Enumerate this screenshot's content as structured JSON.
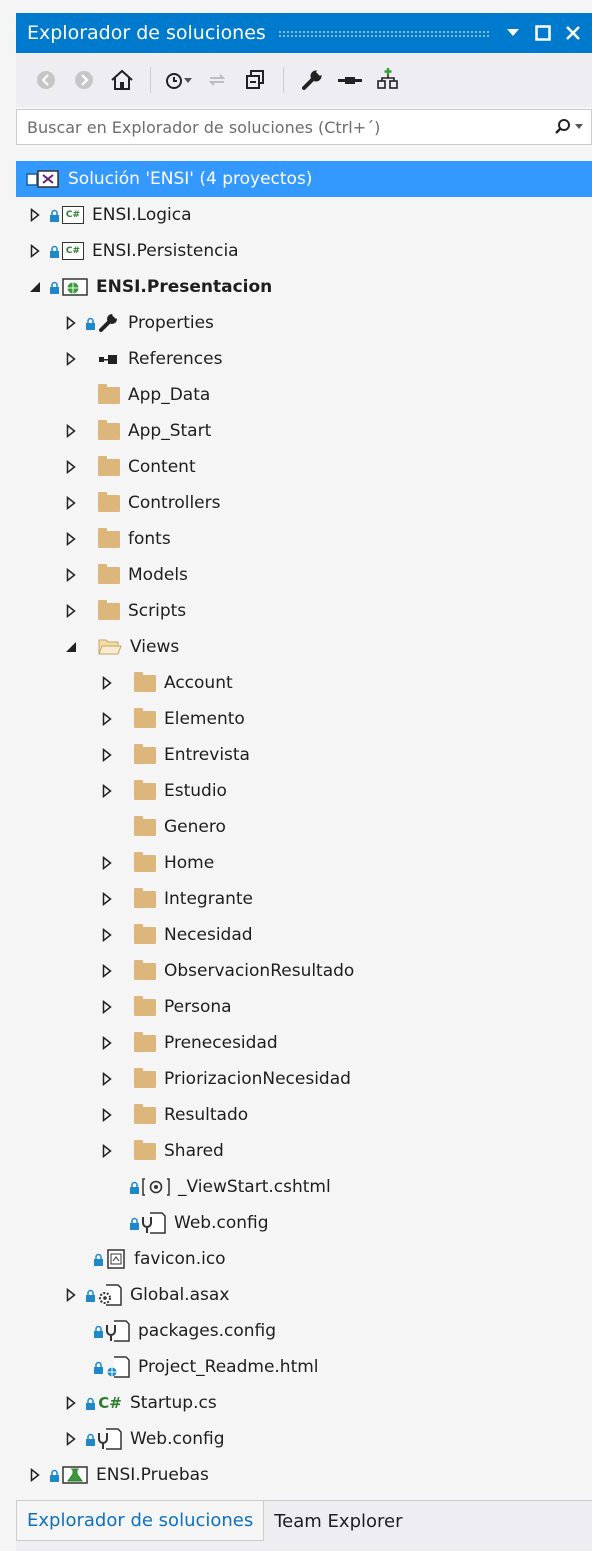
{
  "panel": {
    "title": "Explorador de soluciones"
  },
  "search": {
    "placeholder": "Buscar en Explorador de soluciones (Ctrl+´)"
  },
  "tree": [
    {
      "label": "Solución 'ENSI'  (4 proyectos)"
    },
    {
      "label": "ENSI.Logica"
    },
    {
      "label": "ENSI.Persistencia"
    },
    {
      "label": "ENSI.Presentacion"
    },
    {
      "label": "Properties"
    },
    {
      "label": "References"
    },
    {
      "label": "App_Data"
    },
    {
      "label": "App_Start"
    },
    {
      "label": "Content"
    },
    {
      "label": "Controllers"
    },
    {
      "label": "fonts"
    },
    {
      "label": "Models"
    },
    {
      "label": "Scripts"
    },
    {
      "label": "Views"
    },
    {
      "label": "Account"
    },
    {
      "label": "Elemento"
    },
    {
      "label": "Entrevista"
    },
    {
      "label": "Estudio"
    },
    {
      "label": "Genero"
    },
    {
      "label": "Home"
    },
    {
      "label": "Integrante"
    },
    {
      "label": "Necesidad"
    },
    {
      "label": "ObservacionResultado"
    },
    {
      "label": "Persona"
    },
    {
      "label": "Prenecesidad"
    },
    {
      "label": "PriorizacionNecesidad"
    },
    {
      "label": "Resultado"
    },
    {
      "label": "Shared"
    },
    {
      "label": "_ViewStart.cshtml"
    },
    {
      "label": "Web.config"
    },
    {
      "label": "favicon.ico"
    },
    {
      "label": "Global.asax"
    },
    {
      "label": "packages.config"
    },
    {
      "label": "Project_Readme.html"
    },
    {
      "label": "Startup.cs"
    },
    {
      "label": "Web.config"
    },
    {
      "label": "ENSI.Pruebas"
    }
  ],
  "icons": {
    "csharp_project": "C#",
    "startup_file": "C#"
  },
  "tabs": [
    {
      "label": "Explorador de soluciones"
    },
    {
      "label": "Team Explorer"
    }
  ],
  "colors": {
    "accent": "#007acc",
    "selection": "#3399ff",
    "folder": "#dcb67a",
    "active_tab_text": "#0e70c0"
  }
}
